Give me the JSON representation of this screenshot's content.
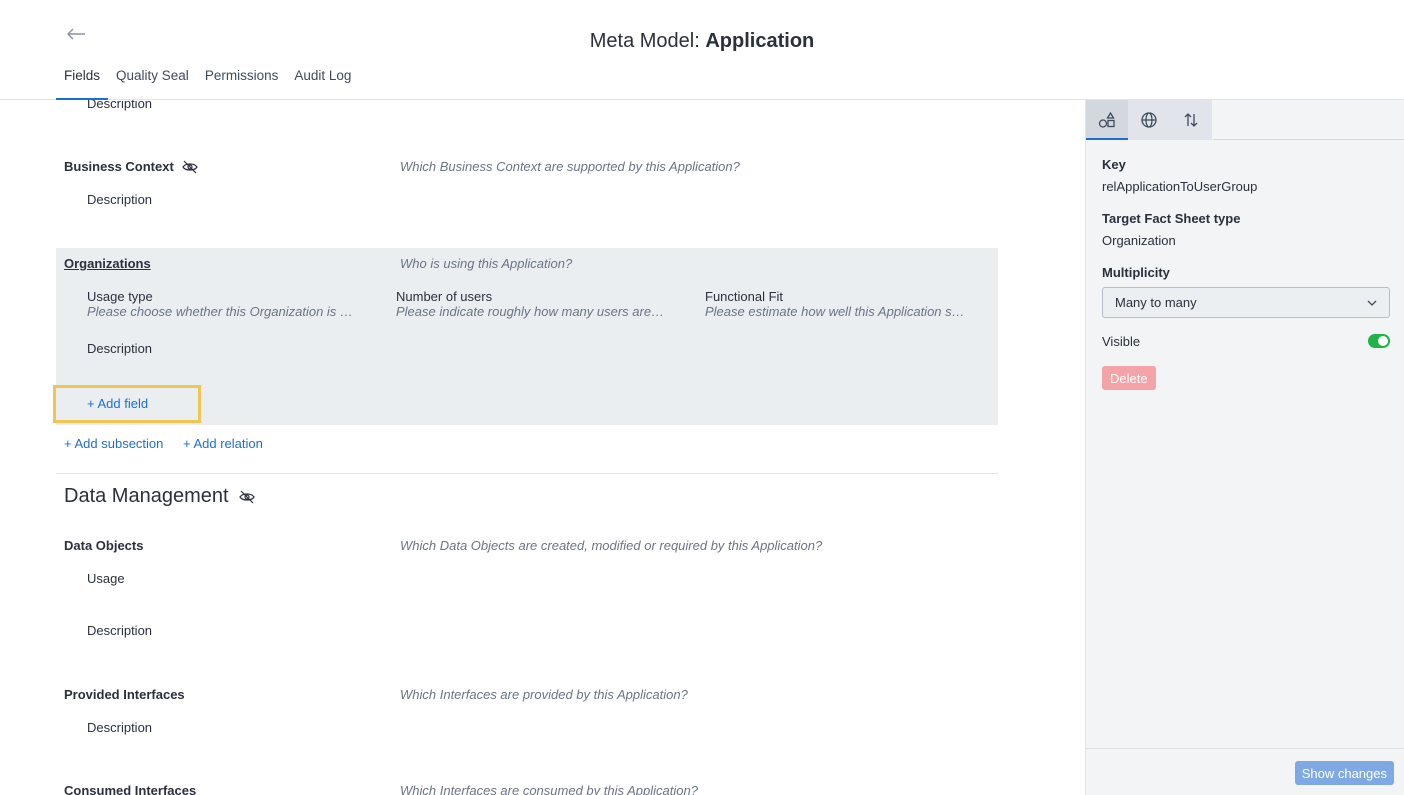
{
  "header": {
    "title_prefix": "Meta Model: ",
    "title_name": "Application",
    "tabs": [
      {
        "label": "Fields"
      },
      {
        "label": "Quality Seal"
      },
      {
        "label": "Permissions"
      },
      {
        "label": "Audit Log"
      }
    ]
  },
  "main": {
    "top_description": "Description",
    "business_context": {
      "title": "Business Context",
      "hint": "Which Business Context are supported by this Application?",
      "description": "Description"
    },
    "organizations": {
      "title": "Organizations",
      "hint": "Who is using this Application?",
      "fields": [
        {
          "label": "Usage type",
          "hint": "Please choose whether this Organization is using this Application"
        },
        {
          "label": "Number of users",
          "hint": "Please indicate roughly how many users are using this Application"
        },
        {
          "label": "Functional Fit",
          "hint": "Please estimate how well this Application supports this Organization"
        }
      ],
      "description": "Description",
      "add_field": "+ Add field"
    },
    "add_subsection": "+ Add subsection",
    "add_relation": "+ Add relation",
    "data_management": {
      "title": "Data Management",
      "data_objects": {
        "title": "Data Objects",
        "hint": "Which Data Objects are created, modified or required by this Application?",
        "usage": "Usage",
        "description": "Description"
      },
      "provided_interfaces": {
        "title": "Provided Interfaces",
        "hint": "Which Interfaces are provided by this Application?",
        "description": "Description"
      },
      "consumed_interfaces": {
        "title": "Consumed Interfaces",
        "hint": "Which Interfaces are consumed by this Application?"
      }
    }
  },
  "panel": {
    "key_label": "Key",
    "key_value": "relApplicationToUserGroup",
    "target_label": "Target Fact Sheet type",
    "target_value": "Organization",
    "multiplicity_label": "Multiplicity",
    "multiplicity_value": "Many to many",
    "visible_label": "Visible",
    "visible_on": true,
    "delete_label": "Delete",
    "show_changes_label": "Show changes"
  }
}
